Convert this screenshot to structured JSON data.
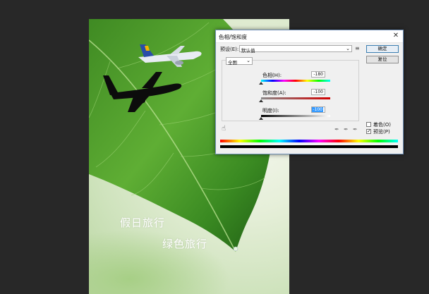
{
  "photo": {
    "text_line1": "假日旅行",
    "text_line2": "绿色旅行"
  },
  "dialog": {
    "title": "色相/饱和度",
    "preset_label": "预设(E):",
    "preset_value": "默认值",
    "preset_options_icon": "preset-options-icon",
    "ok_label": "确定",
    "cancel_label": "复位",
    "channel_value": "全图",
    "hue_label": "色相(H):",
    "hue_value": "-180",
    "saturation_label": "饱和度(A):",
    "saturation_value": "-100",
    "lightness_label": "明度(I):",
    "lightness_value": "-100",
    "colorize_label": "着色(O)",
    "colorize_checked": false,
    "preview_label": "预览(P)",
    "preview_checked": true,
    "check_mark": "✓",
    "close_glyph": "✕",
    "chevron_glyph": "⌄",
    "hand_glyph": "☝",
    "eyedropper_glyph": "✒"
  },
  "colors": {
    "workspace": "#282828",
    "dialog_border": "#6e8fb8",
    "selection": "#3399ff",
    "leaf_dark": "#1e5a12",
    "leaf_light": "#7cc24a"
  }
}
